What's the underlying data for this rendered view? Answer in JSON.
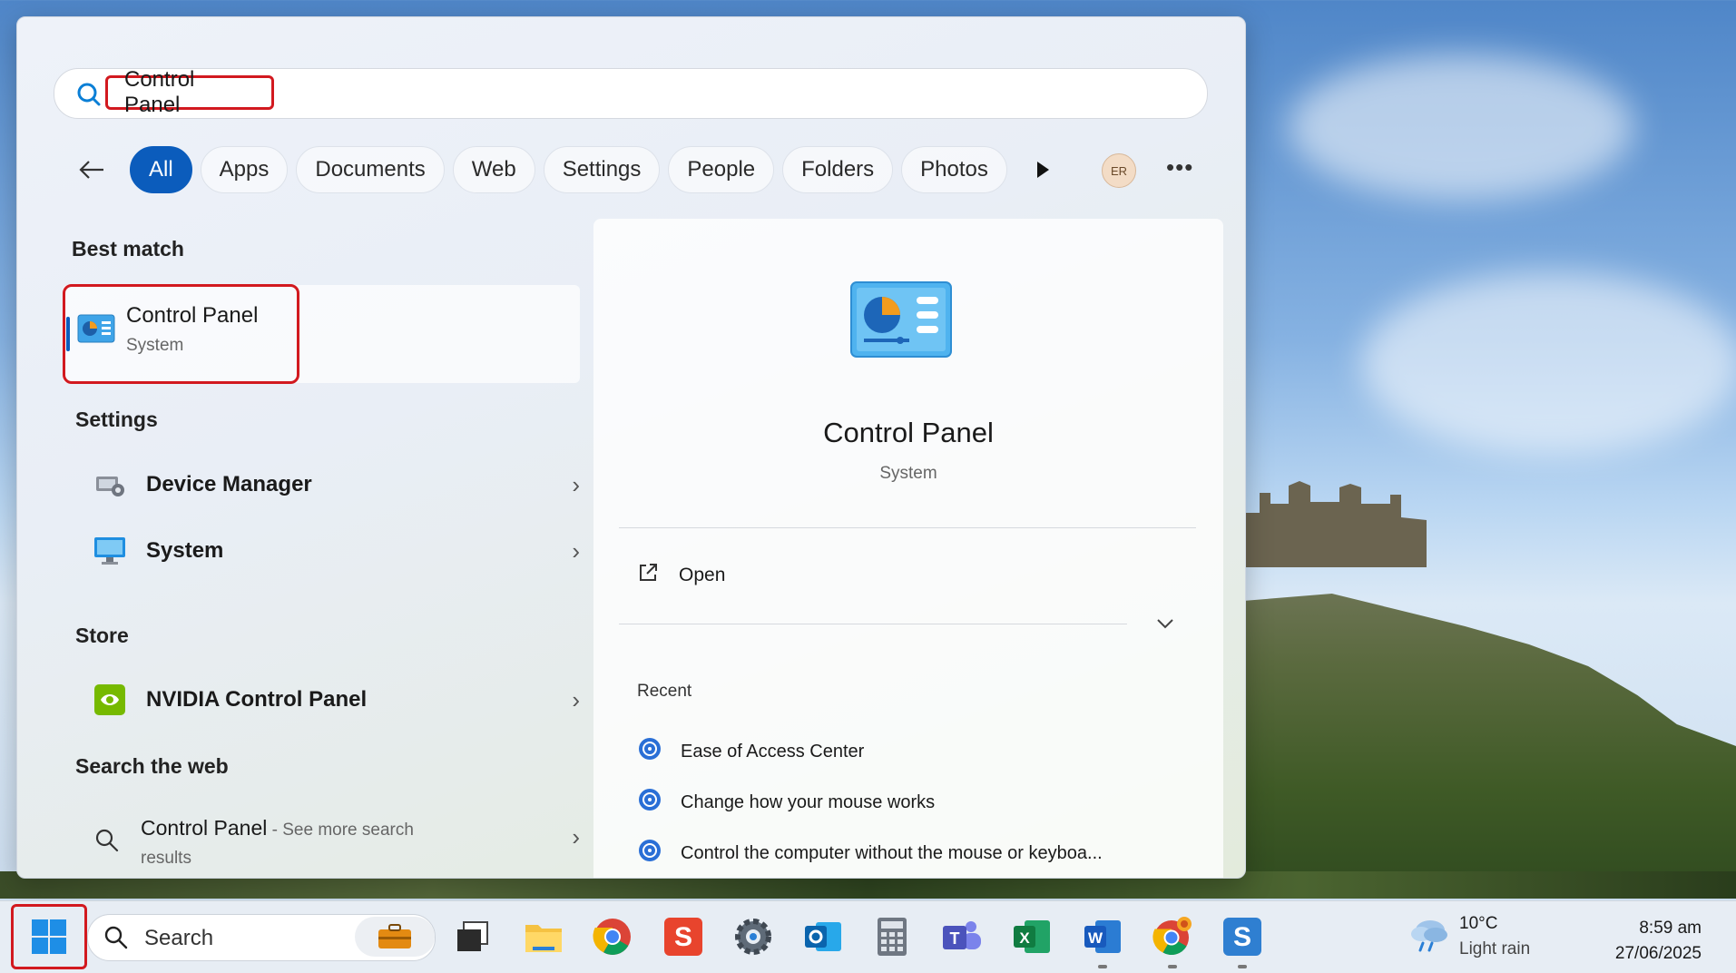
{
  "search": {
    "query": "Control Panel"
  },
  "filters": [
    "All",
    "Apps",
    "Documents",
    "Web",
    "Settings",
    "People",
    "Folders",
    "Photos"
  ],
  "account": {
    "initials": "ER"
  },
  "best_match": {
    "heading": "Best match",
    "title": "Control Panel",
    "subtitle": "System"
  },
  "settings": {
    "heading": "Settings",
    "items": [
      {
        "label": "Device Manager",
        "icon": "device-manager-icon"
      },
      {
        "label": "System",
        "icon": "monitor-icon"
      }
    ]
  },
  "store": {
    "heading": "Store",
    "items": [
      {
        "label": "NVIDIA Control Panel",
        "icon": "nvidia-icon"
      }
    ]
  },
  "web": {
    "heading": "Search the web",
    "query": "Control Panel",
    "suffix": " - See more search",
    "suffix2": "results"
  },
  "details": {
    "title": "Control Panel",
    "subtitle": "System",
    "open_label": "Open",
    "recent_heading": "Recent",
    "recent": [
      "Ease of Access Center",
      "Change how your mouse works",
      "Control the computer without the mouse or keyboa..."
    ]
  },
  "taskbar": {
    "search_placeholder": "Search",
    "apps": [
      "task-view",
      "file-explorer",
      "chrome",
      "snagit",
      "settings",
      "outlook",
      "calculator",
      "teams",
      "excel",
      "word",
      "chrome-profile",
      "snagit-editor"
    ],
    "weather": {
      "temp": "10°C",
      "condition": "Light rain"
    },
    "clock": {
      "time": "8:59 am",
      "date": "27/06/2025"
    }
  },
  "colors": {
    "accent": "#0b5cbc",
    "highlight": "#d2191f"
  }
}
